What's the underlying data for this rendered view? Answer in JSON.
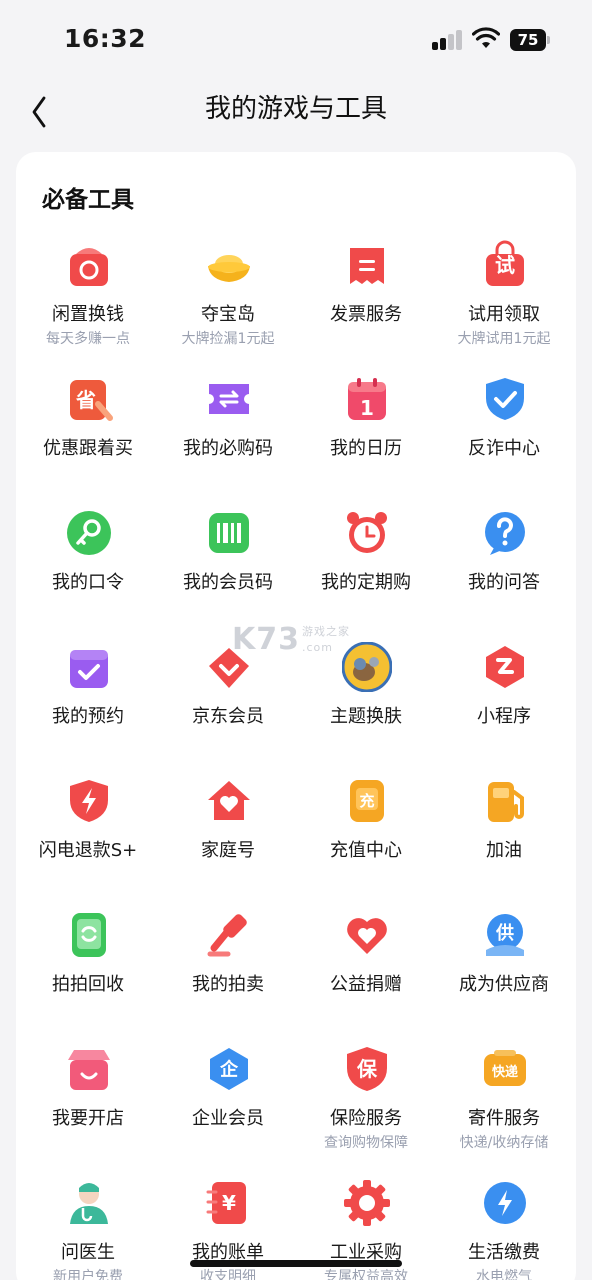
{
  "status": {
    "time": "16:32",
    "battery": "75"
  },
  "nav": {
    "title": "我的游戏与工具"
  },
  "section": {
    "title": "必备工具"
  },
  "tools": [
    {
      "label": "闲置换钱",
      "sub": "每天多赚一点",
      "icon": "recycle-bag-icon"
    },
    {
      "label": "夺宝岛",
      "sub": "大牌捡漏1元起",
      "icon": "gold-ingot-icon"
    },
    {
      "label": "发票服务",
      "sub": "",
      "icon": "invoice-icon"
    },
    {
      "label": "试用领取",
      "sub": "大牌试用1元起",
      "icon": "trial-bag-icon"
    },
    {
      "label": "优惠跟着买",
      "sub": "",
      "icon": "save-money-icon"
    },
    {
      "label": "我的必购码",
      "sub": "",
      "icon": "ticket-icon"
    },
    {
      "label": "我的日历",
      "sub": "",
      "icon": "calendar-icon"
    },
    {
      "label": "反诈中心",
      "sub": "",
      "icon": "shield-check-icon"
    },
    {
      "label": "我的口令",
      "sub": "",
      "icon": "key-icon"
    },
    {
      "label": "我的会员码",
      "sub": "",
      "icon": "barcode-icon"
    },
    {
      "label": "我的定期购",
      "sub": "",
      "icon": "alarm-clock-icon"
    },
    {
      "label": "我的问答",
      "sub": "",
      "icon": "question-icon"
    },
    {
      "label": "我的预约",
      "sub": "",
      "icon": "reservation-icon"
    },
    {
      "label": "京东会员",
      "sub": "",
      "icon": "member-diamond-icon"
    },
    {
      "label": "主题换肤",
      "sub": "",
      "icon": "theme-avatar-icon"
    },
    {
      "label": "小程序",
      "sub": "",
      "icon": "mini-program-icon"
    },
    {
      "label": "闪电退款S+",
      "sub": "",
      "icon": "lightning-shield-icon"
    },
    {
      "label": "家庭号",
      "sub": "",
      "icon": "home-heart-icon"
    },
    {
      "label": "充值中心",
      "sub": "",
      "icon": "recharge-icon"
    },
    {
      "label": "加油",
      "sub": "",
      "icon": "fuel-pump-icon"
    },
    {
      "label": "拍拍回收",
      "sub": "",
      "icon": "phone-recycle-icon"
    },
    {
      "label": "我的拍卖",
      "sub": "",
      "icon": "auction-hammer-icon"
    },
    {
      "label": "公益捐赠",
      "sub": "",
      "icon": "charity-heart-icon"
    },
    {
      "label": "成为供应商",
      "sub": "",
      "icon": "supplier-icon"
    },
    {
      "label": "我要开店",
      "sub": "",
      "icon": "open-store-icon"
    },
    {
      "label": "企业会员",
      "sub": "",
      "icon": "enterprise-icon"
    },
    {
      "label": "保险服务",
      "sub": "查询购物保障",
      "icon": "insurance-shield-icon"
    },
    {
      "label": "寄件服务",
      "sub": "快递/收纳存储",
      "icon": "express-icon"
    },
    {
      "label": "问医生",
      "sub": "新用户免费",
      "icon": "doctor-icon"
    },
    {
      "label": "我的账单",
      "sub": "收支明细",
      "icon": "bill-icon"
    },
    {
      "label": "工业采购",
      "sub": "专属权益高效",
      "icon": "industrial-gear-icon"
    },
    {
      "label": "生活缴费",
      "sub": "水电燃气",
      "icon": "utility-drop-icon"
    }
  ],
  "icon_text": {
    "trial": "试",
    "save": "省",
    "recharge": "充",
    "supplier": "供",
    "enterprise": "企",
    "insurance": "保",
    "express": "快递",
    "bill": "¥",
    "calendar": "1"
  },
  "watermark": {
    "brand": "K73",
    "cn": "游戏之家",
    "domain": ".com"
  },
  "colors": {
    "accent_red": "#f04a4a",
    "blue": "#3a8ff0",
    "green": "#3cc45a",
    "purple": "#9a5cf0",
    "orange": "#f5a623"
  }
}
